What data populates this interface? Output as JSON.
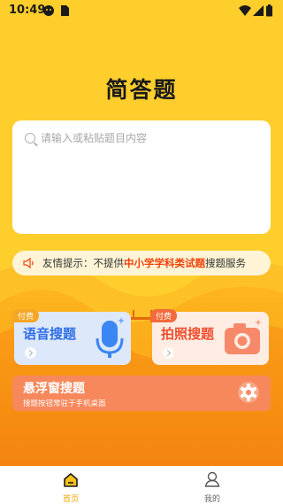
{
  "status_bar": {
    "time": "10:49"
  },
  "app_title": "简答题",
  "search": {
    "placeholder": "请输入或粘贴题目内容"
  },
  "notice": {
    "prefix": "友情提示：不提供",
    "highlight": "中小学学科类试题",
    "suffix": "搜题服务"
  },
  "cards": {
    "voice": {
      "badge": "付费",
      "title": "语音搜题",
      "icon": "microphone-icon"
    },
    "photo": {
      "badge": "付费",
      "title": "拍照搜题",
      "icon": "camera-icon"
    },
    "floating": {
      "title": "悬浮窗搜题",
      "subtitle": "搜题按钮常驻于手机桌面",
      "icon": "gear-icon"
    }
  },
  "bottom_nav": [
    {
      "label": "首页",
      "icon": "home-icon",
      "active": true
    },
    {
      "label": "我的",
      "icon": "profile-icon",
      "active": false
    }
  ],
  "colors": {
    "background": "#FECE2D",
    "accent": "#F2420B",
    "voice_title": "#2F6FE6",
    "photo_title": "#F04E2E",
    "floating_card": "#F6885B",
    "nav_active": "#F3A400"
  }
}
